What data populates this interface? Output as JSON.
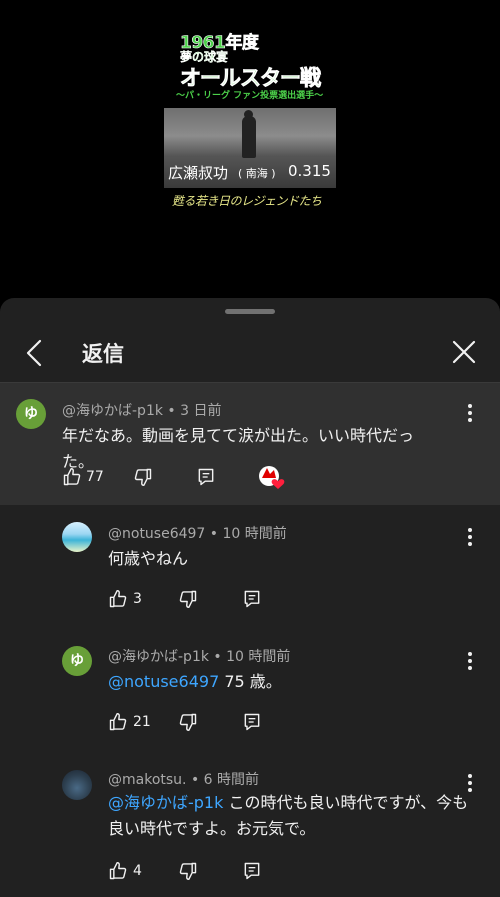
{
  "video": {
    "thumb_year": "1961年度",
    "thumb_sub": "夢の球宴",
    "thumb_main": "オールスター戦",
    "thumb_tag": "〜パ・リーグ ファン投票選出選手〜",
    "caption_name": "広瀬叔功",
    "caption_team": "( 南海 )",
    "caption_avg": "0.315",
    "caption_legend": "甦る若き日のレジェンドたち"
  },
  "sheet": {
    "title": "返信"
  },
  "root_comment": {
    "author": "@海ゆかば-p1k",
    "time": "3 日前",
    "avatar_letter": "ゆ",
    "text": "年だなあ。動画を見てて涙が出た。いい時代だった。",
    "likes": "77"
  },
  "replies": [
    {
      "author": "@notuse6497",
      "time": "10 時間前",
      "text": "何歳やねん",
      "likes": "3"
    },
    {
      "author": "@海ゆかば-p1k",
      "time": "10 時間前",
      "avatar_letter": "ゆ",
      "mention": "@notuse6497",
      "text": " 75 歳。",
      "likes": "21"
    },
    {
      "author": "@makotsu.",
      "time": "6 時間前",
      "mention": "@海ゆかば-p1k",
      "text": " この時代も良い時代ですが、今も良い時代ですよ。お元気で。",
      "likes": "4"
    }
  ],
  "colors": {
    "background": "#000000",
    "sheet": "#212121",
    "highlight": "#303030",
    "mention": "#3ea6ff",
    "avatar_green": "#689f38"
  },
  "icons": [
    "chevron-left-icon",
    "close-icon",
    "like-icon",
    "dislike-icon",
    "reply-icon",
    "creator-heart-icon",
    "more-vert-icon"
  ]
}
